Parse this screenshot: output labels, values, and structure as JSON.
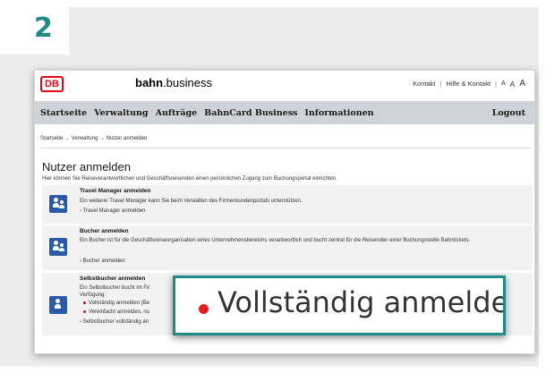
{
  "step": "2",
  "header": {
    "logo": "DB",
    "brand_bold": "bahn",
    "brand_rest": ".business",
    "links": [
      "Kontakt",
      "Hilfe & Kontakt"
    ],
    "font_sizes": [
      "A",
      "A",
      "A"
    ]
  },
  "nav": {
    "items": [
      "Startseite",
      "Verwaltung",
      "Aufträge",
      "BahnCard Business",
      "Informationen"
    ],
    "logout": "Logout"
  },
  "breadcrumb": "Startseite → Verwaltung → Nutzer anmelden",
  "page": {
    "title": "Nutzer anmelden",
    "intro": "Hier können Sie Reiseverantwortlichen und Geschäftsreisenden einen persönlichen Zugang zum Buchungsportal einrichten."
  },
  "sections": [
    {
      "title": "Travel Manager anmelden",
      "text": "Ein weiterer Travel Manager kann Sie beim Verwalten des Firmenkundenportals unterstützen.",
      "link": "Travel Manager anmelden"
    },
    {
      "title": "Bucher anmelden",
      "text": "Ein Bucher ist für die Geschäftsreiseorganisation eines Unternehmensbereichs verantwortlich und bucht zentral für die Reisenden einer Buchungsstelle Bahntickets.",
      "link": "Bucher anmelden"
    },
    {
      "title": "Selbstbucher anmelden",
      "text_line1": "Ein Selbstbucher bucht im Fir",
      "text_line2": "Verfügung:",
      "bullets": [
        "Vollständig anmelden (Be",
        "Vereinfacht anmelden, nu"
      ],
      "link": "Selbstbucher vollständig an"
    }
  ],
  "callout": {
    "text": "Vollständig anmelden ("
  },
  "colors": {
    "accent_teal": "#1f8b87",
    "db_red": "#ec0016",
    "nav_bg": "#cdd3d8",
    "icon_blue": "#2b5aa8"
  }
}
